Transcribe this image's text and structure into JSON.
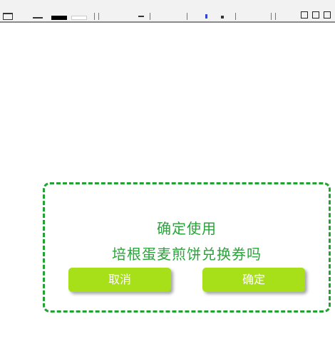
{
  "dialog": {
    "line1": "确定使用",
    "line2": "培根蛋麦煎饼兑换券吗",
    "cancel_label": "取消",
    "confirm_label": "确定"
  },
  "colors": {
    "accent_green": "#22a232",
    "text_green": "#2aa33a",
    "button_green": "#a7df19"
  }
}
